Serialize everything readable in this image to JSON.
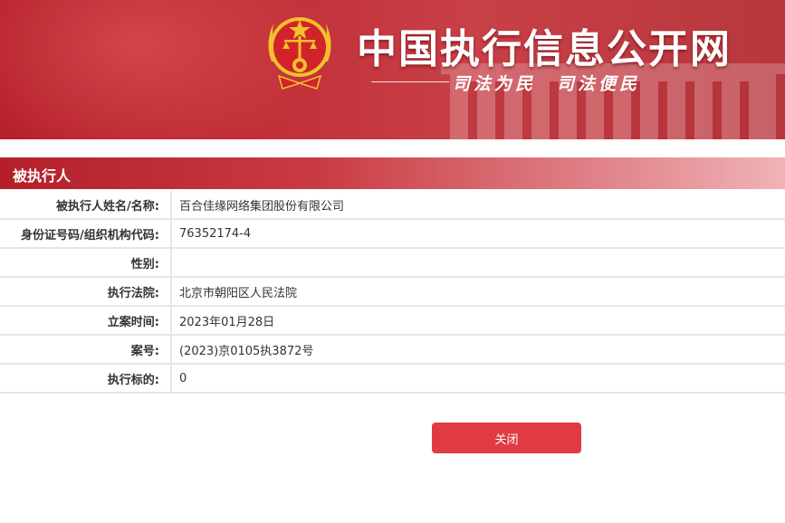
{
  "header": {
    "title": "中国执行信息公开网",
    "slogan": "司法为民　司法便民",
    "emblem_icon": "court-emblem-icon"
  },
  "section": {
    "title": "被执行人"
  },
  "details": [
    {
      "label": "被执行人姓名/名称:",
      "value": "百合佳缘网络集团股份有限公司"
    },
    {
      "label": "身份证号码/组织机构代码:",
      "value": "76352174-4"
    },
    {
      "label": "性别:",
      "value": ""
    },
    {
      "label": "执行法院:",
      "value": "北京市朝阳区人民法院"
    },
    {
      "label": "立案时间:",
      "value": "2023年01月28日"
    },
    {
      "label": "案号:",
      "value": "(2023)京0105执3872号"
    },
    {
      "label": "执行标的:",
      "value": "0"
    }
  ],
  "actions": {
    "close_label": "关闭"
  },
  "colors": {
    "brand_red": "#b5212b",
    "button_red": "#e03a42",
    "emblem_gold": "#f2c12e"
  }
}
